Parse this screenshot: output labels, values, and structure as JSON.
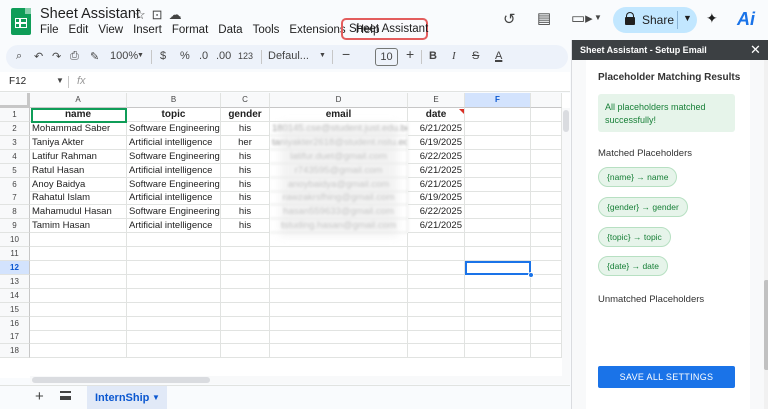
{
  "doc": {
    "title": "Sheet Assistant",
    "menu": [
      "File",
      "Edit",
      "View",
      "Insert",
      "Format",
      "Data",
      "Tools",
      "Extensions",
      "Help"
    ],
    "menu_highlight": "Sheet Assistant"
  },
  "header": {
    "share_label": "Share",
    "icons": [
      "star-icon",
      "move-to-folder-icon",
      "cloud-status-icon",
      "history-icon",
      "comment-icon",
      "video-call-icon",
      "sparkle-icon",
      "ai-logo-icon"
    ],
    "ai_logo_text": "Ai"
  },
  "toolbar": {
    "zoom": "100%",
    "currency": "$",
    "percent": "%",
    "decimal_dec": ".0",
    "decimal_inc": ".00",
    "number_format": "123",
    "font": "Defaul...",
    "font_size": "10",
    "bold": "B",
    "italic": "I",
    "strike": "S",
    "text_color": "A"
  },
  "formula": {
    "cell_ref": "F12",
    "fx": "fx"
  },
  "grid": {
    "columns": [
      "A",
      "B",
      "C",
      "D",
      "E",
      "F"
    ],
    "rows": [
      "1",
      "2",
      "3",
      "4",
      "5",
      "6",
      "7",
      "8",
      "9",
      "10",
      "11",
      "12",
      "13",
      "14",
      "15",
      "16",
      "17",
      "18"
    ],
    "active_row": "12",
    "active_col": "F",
    "headers": [
      "name",
      "topic",
      "gender",
      "email",
      "date"
    ],
    "data": [
      {
        "name": "Mohammad Saber",
        "topic": "Software Engineering",
        "gender": "his",
        "email": "180145.cse@student.just.edu.bd",
        "date": "6/21/2025"
      },
      {
        "name": "Taniya Akter",
        "topic": "Artificial intelligence",
        "gender": "her",
        "email": "taniyakter2618@student.nstu.edu.bd",
        "date": "6/19/2025"
      },
      {
        "name": "Latifur Rahman",
        "topic": "Software Engineering",
        "gender": "his",
        "email": "latifur.duet@gmail.com",
        "date": "6/22/2025"
      },
      {
        "name": "Ratul Hasan",
        "topic": "Artificial intelligence",
        "gender": "his",
        "email": "r743595@gmail.com",
        "date": "6/21/2025"
      },
      {
        "name": "Anoy Baidya",
        "topic": "Software Engineering",
        "gender": "his",
        "email": "anoybaidya@gmail.com",
        "date": "6/21/2025"
      },
      {
        "name": "Rahatul Islam",
        "topic": "Artificial intelligence",
        "gender": "his",
        "email": "rawzakrsfhing@gmail.com",
        "date": "6/19/2025"
      },
      {
        "name": "Mahamudul Hasan",
        "topic": "Software Engineering",
        "gender": "his",
        "email": "hasan559633@gmail.com",
        "date": "6/22/2025"
      },
      {
        "name": "Tamim Hasan",
        "topic": "Artificial intelligence",
        "gender": "his",
        "email": "tstuding.hasan@gmail.com",
        "date": "6/21/2025"
      }
    ]
  },
  "sheets": {
    "active_tab": "InternShip"
  },
  "panel": {
    "title": "Sheet Assistant - Setup Email",
    "section_title": "Placeholder Matching Results",
    "success_message": "All placeholders matched successfully!",
    "matched_label": "Matched Placeholders",
    "matched": [
      "{name} → name",
      "{gender} → gender",
      "{topic} → topic",
      "{date} → date"
    ],
    "unmatched_label": "Unmatched Placeholders",
    "save_label": "SAVE ALL SETTINGS"
  }
}
